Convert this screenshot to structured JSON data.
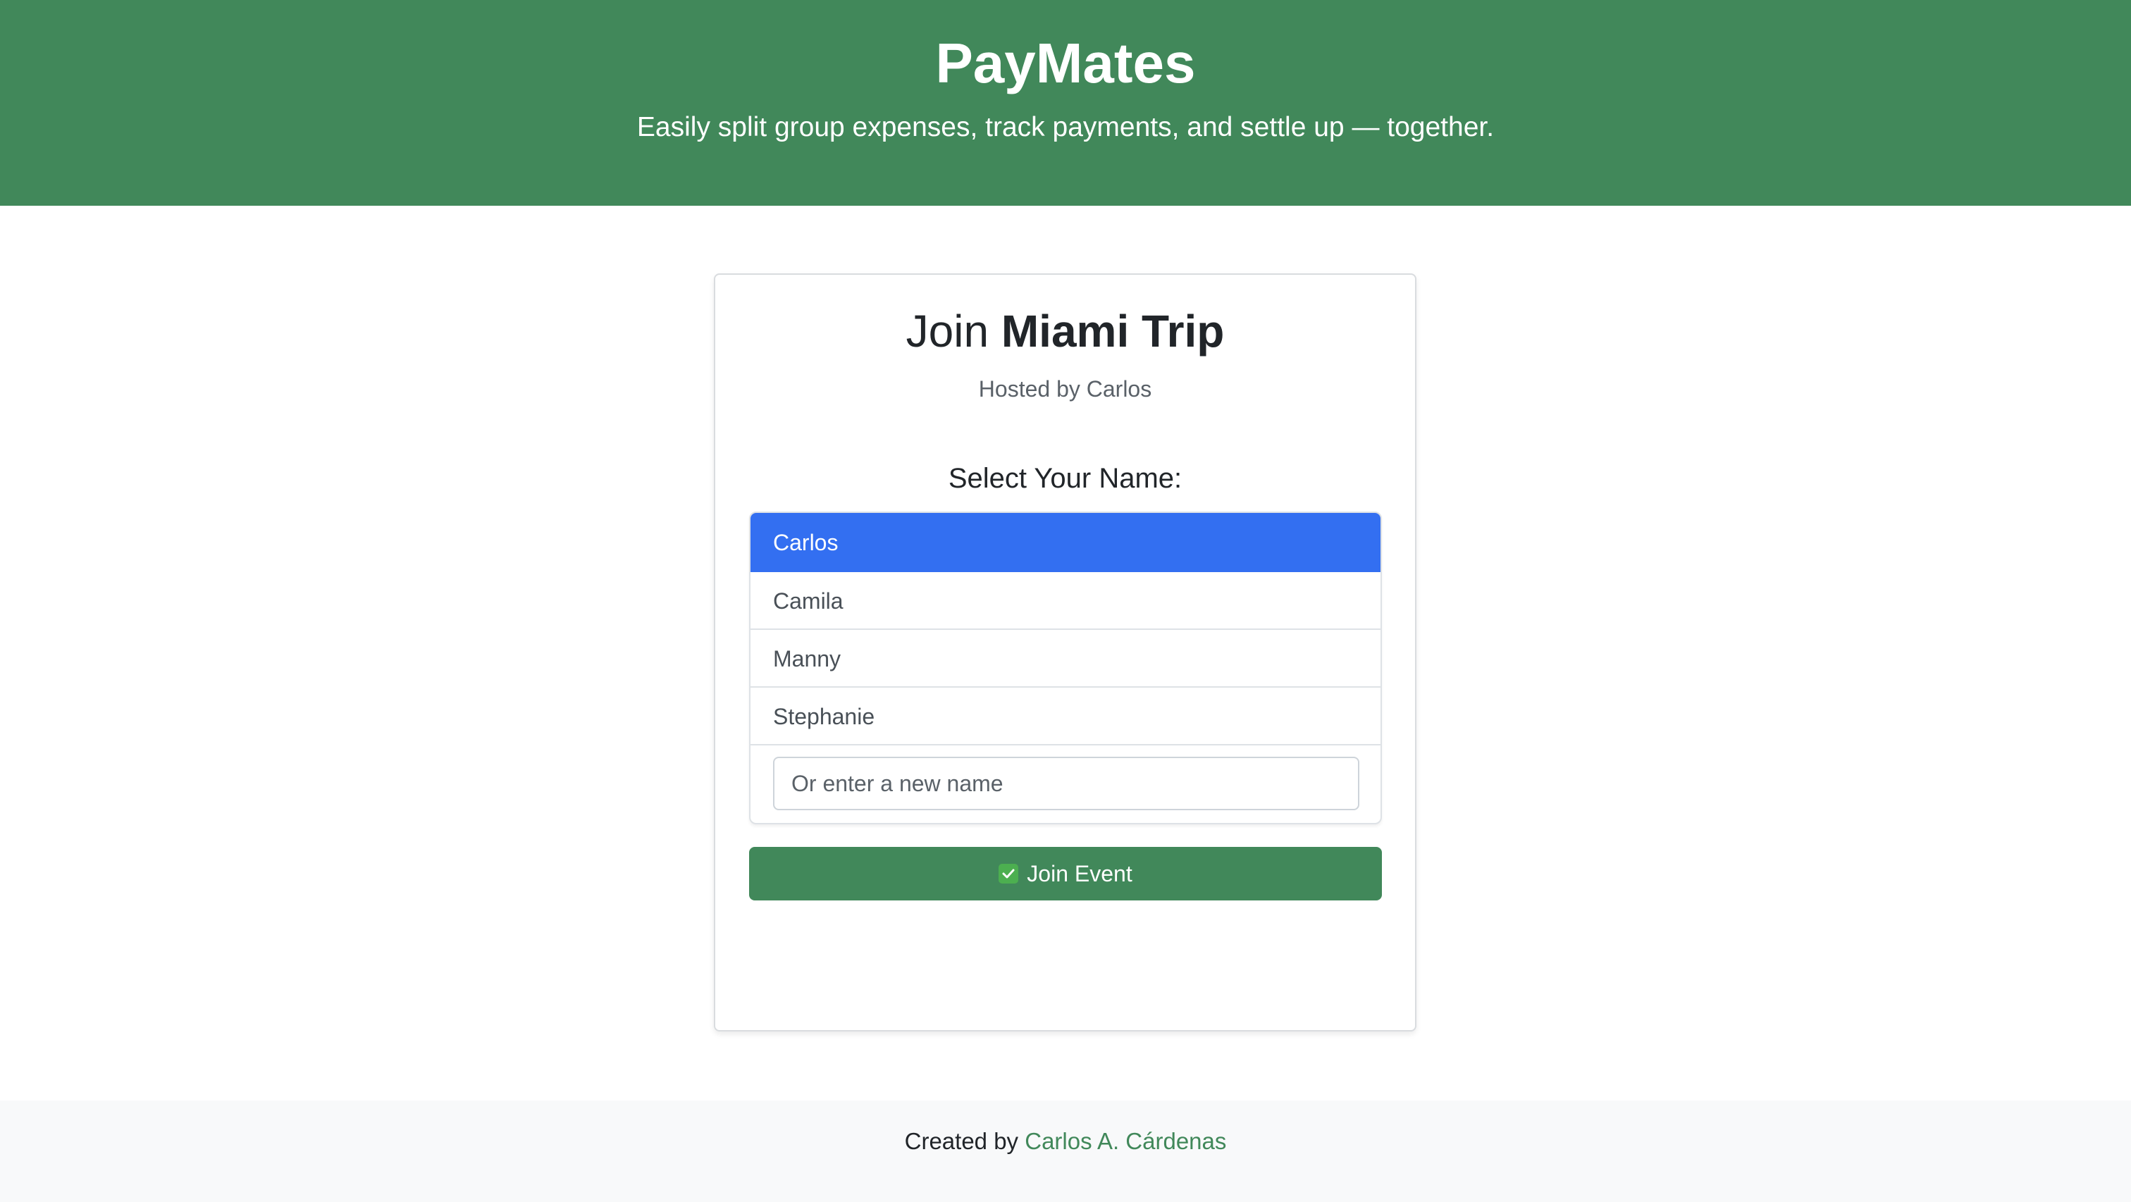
{
  "header": {
    "title": "PayMates",
    "tagline": "Easily split group expenses, track payments, and settle up — together."
  },
  "card": {
    "title_prefix": "Join",
    "event_name": "Miami Trip",
    "hosted_by": "Hosted by Carlos",
    "select_label": "Select Your Name:",
    "names": [
      {
        "label": "Carlos",
        "selected": true
      },
      {
        "label": "Camila",
        "selected": false
      },
      {
        "label": "Manny",
        "selected": false
      },
      {
        "label": "Stephanie",
        "selected": false
      }
    ],
    "new_name_placeholder": "Or enter a new name",
    "new_name_value": "",
    "join_label": "Join Event",
    "join_icon": "check-box-icon"
  },
  "footer": {
    "credit_prefix": "Created by",
    "author": "Carlos A. Cárdenas"
  },
  "colors": {
    "brand_green": "#41885a",
    "selected_blue": "#336ff1"
  }
}
